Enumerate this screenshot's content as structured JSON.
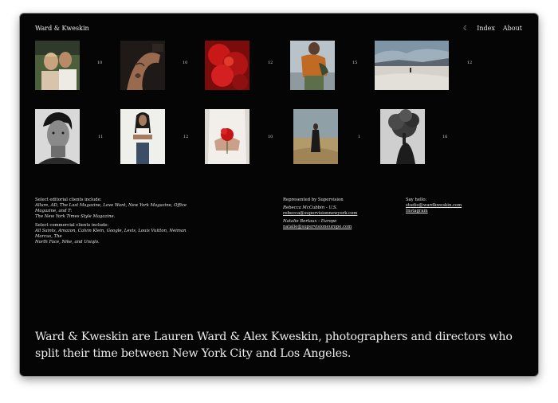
{
  "header": {
    "brand": "Ward & Kweskin",
    "nav": [
      {
        "label": "Index"
      },
      {
        "label": "About"
      }
    ]
  },
  "gallery": {
    "rows": [
      [
        {
          "name": "couple-embrace",
          "count": "10"
        },
        {
          "name": "tattooed-arm",
          "count": "10"
        },
        {
          "name": "red-flowers",
          "count": "12"
        },
        {
          "name": "orange-jacket-man",
          "count": "15"
        },
        {
          "name": "desert-landscape",
          "count": "12"
        }
      ],
      [
        {
          "name": "bw-portrait-man",
          "count": "11"
        },
        {
          "name": "woman-white-backdrop",
          "count": "12"
        },
        {
          "name": "hands-red-flower",
          "count": "10"
        },
        {
          "name": "figure-in-field",
          "count": "1"
        },
        {
          "name": "bw-tree-figure",
          "count": "16"
        }
      ]
    ]
  },
  "clients": {
    "editorial_heading": "Select editorial clients include:",
    "editorial_lines": [
      "Allure, AD, The Last Magazine, Love Want, New York Magazine, Office Magazine, and T:",
      "The New York Times Style Magazine."
    ],
    "commercial_heading": "Select commercial clients include:",
    "commercial_lines": [
      "All Saints, Amazon, Calvin Klein, Google, Levis, Louis Vuitton, Neiman Marcus, The",
      "North Face, Nike, and Uniqlo."
    ]
  },
  "representation": {
    "heading": "Represented by Supervision",
    "agents": [
      {
        "name": "Rebecca McCubbin - U.S.",
        "email": "rebecca@supervisionnewyork.com"
      },
      {
        "name": "Natalie Bertaux - Europe",
        "email": "natalie@supervisioneurope.com"
      }
    ]
  },
  "contact": {
    "heading": "Say hello:",
    "email": "studio@wardkweskin.com",
    "instagram": "Instagram"
  },
  "bio": {
    "text": "Ward & Kweskin are Lauren Ward & Alex Kweskin, photographers and directors who split their time between New York City and Los Angeles."
  }
}
